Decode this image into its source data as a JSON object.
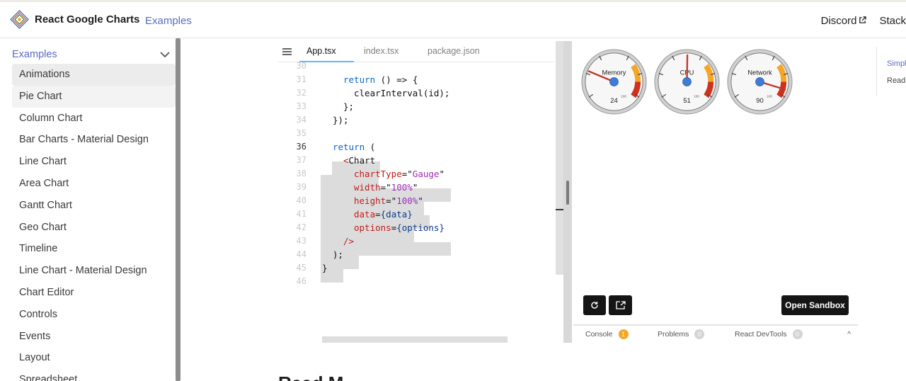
{
  "navbar": {
    "brand": "React Google Charts",
    "examples_link": "Examples",
    "discord_link": "Discord",
    "stack_link": "Stack"
  },
  "sidebar": {
    "category": "Examples",
    "items": [
      {
        "label": "Animations"
      },
      {
        "label": "Pie Chart"
      },
      {
        "label": "Column Chart"
      },
      {
        "label": "Bar Charts - Material Design"
      },
      {
        "label": "Line Chart"
      },
      {
        "label": "Area Chart"
      },
      {
        "label": "Gantt Chart"
      },
      {
        "label": "Geo Chart"
      },
      {
        "label": "Timeline"
      },
      {
        "label": "Line Chart - Material Design"
      },
      {
        "label": "Chart Editor"
      },
      {
        "label": "Controls"
      },
      {
        "label": "Events"
      },
      {
        "label": "Layout"
      },
      {
        "label": "Spreadsheet"
      }
    ]
  },
  "editor": {
    "tabs": [
      "App.tsx",
      "index.tsx",
      "package.json"
    ],
    "active_tab": "App.tsx",
    "line_numbers": [
      "30",
      "31",
      "32",
      "33",
      "34",
      "35",
      "36",
      "37",
      "38",
      "39",
      "40",
      "41",
      "42",
      "43",
      "44",
      "45",
      "46"
    ],
    "current_line": "36",
    "code": {
      "l31_kw": "return",
      "l31_rest": " () => {",
      "l32": "clearInterval(id);",
      "l33": "};",
      "l34": "});",
      "l36_kw": "return",
      "l36_rest": " (",
      "l37_open": "<",
      "l37_tag": "Chart",
      "l38_attr": "chartType",
      "l38_val": "Gauge",
      "l39_attr": "width",
      "l39_val": "100%",
      "l40_attr": "height",
      "l40_val": "100%",
      "l41_attr": "data",
      "l41_val": "data",
      "l42_attr": "options",
      "l42_val": "options",
      "l43": "/>",
      "l44": ");",
      "l45": "}"
    }
  },
  "preview": {
    "gauges": [
      {
        "label": "Memory",
        "value": 24
      },
      {
        "label": "CPU",
        "value": 51
      },
      {
        "label": "Network",
        "value": 90
      }
    ],
    "gauge_max_tick": "100",
    "open_sandbox": "Open Sandbox",
    "console_tabs": [
      {
        "label": "Console",
        "badge": "1"
      },
      {
        "label": "Problems",
        "badge": "0"
      },
      {
        "label": "React DevTools",
        "badge": "0"
      }
    ],
    "collapse_glyph": "^"
  },
  "toc": {
    "item1": "Simpl",
    "item2": "Read"
  },
  "page_heading": "Read M",
  "colors": {
    "accent": "#5c6bc0",
    "keyword": "#0d66c9",
    "attribute": "#c21c1c",
    "string": "#9b2eb7",
    "needle": "#c0392b",
    "gauge_orange": "#f5a623",
    "gauge_red": "#d0311c",
    "dark_button": "#151515"
  }
}
